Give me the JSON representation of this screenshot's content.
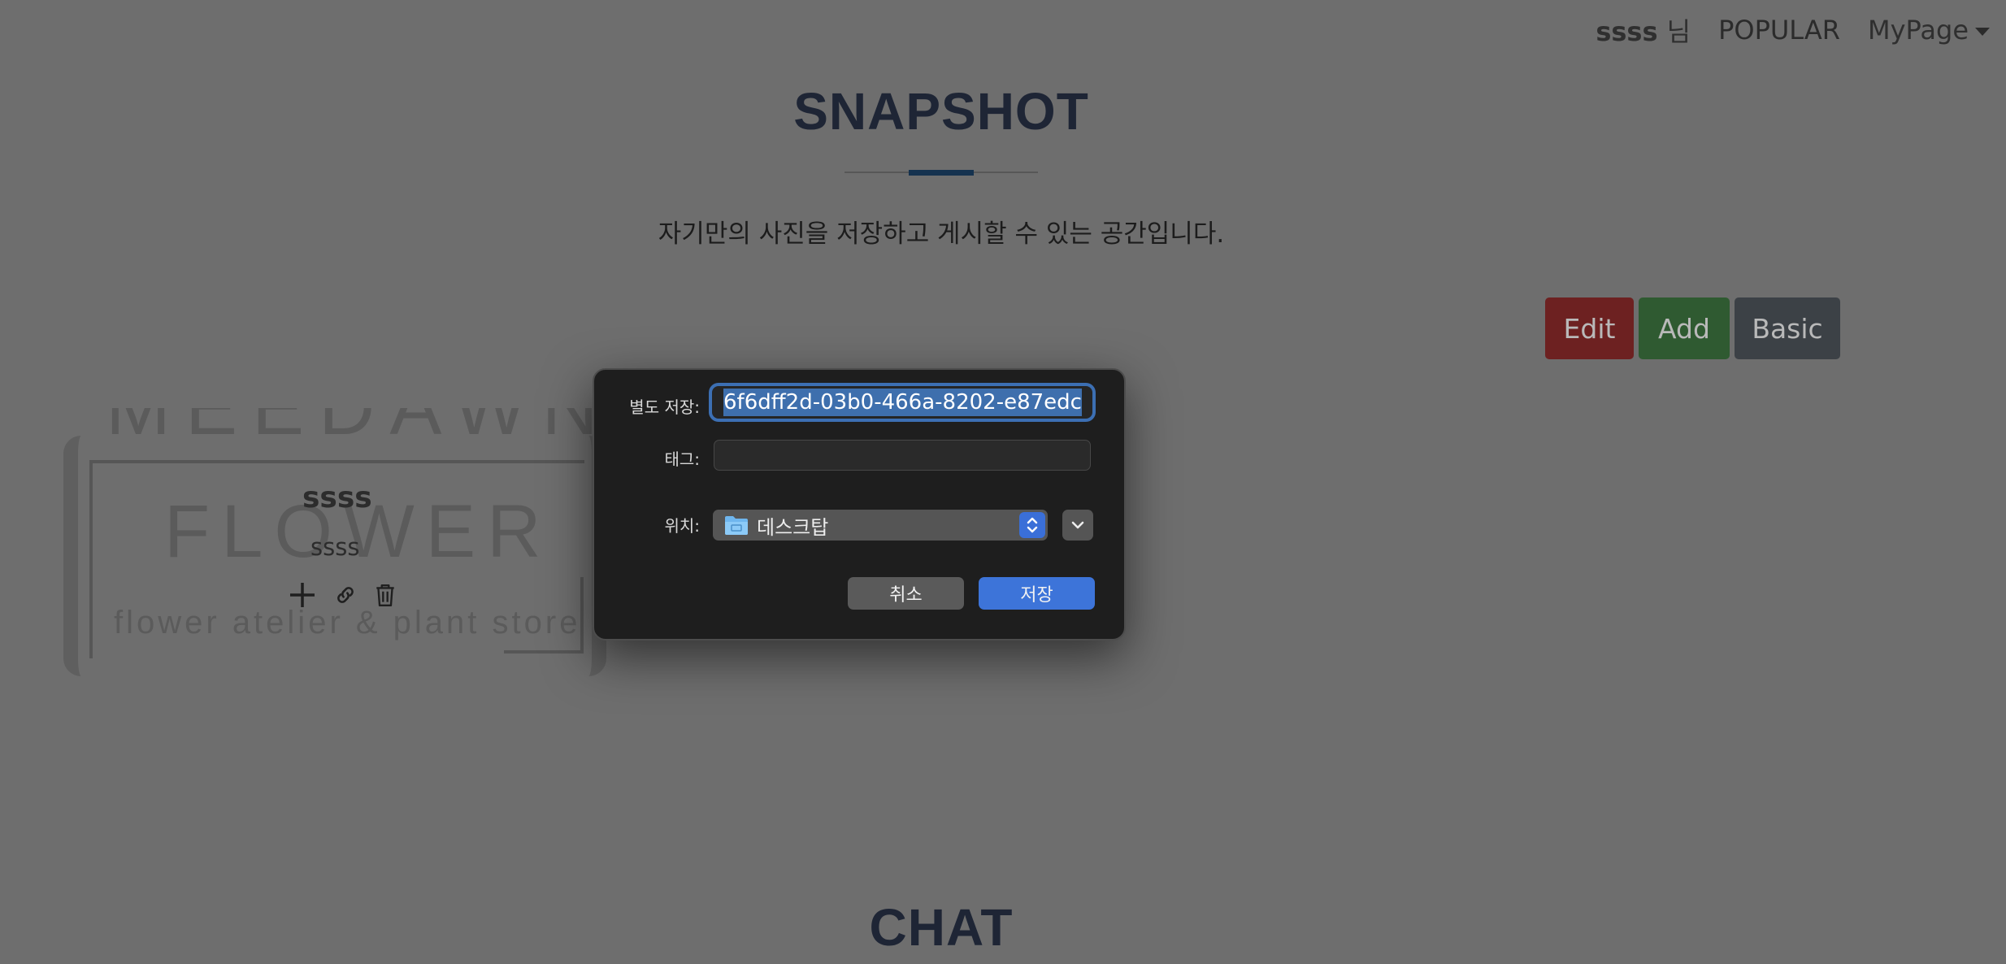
{
  "nav": {
    "user": "ssss",
    "user_suffix": "님",
    "popular": "POPULAR",
    "mypage": "MyPage"
  },
  "snapshot": {
    "title": "SNAPSHOT",
    "subtitle": "자기만의 사진을 저장하고 게시할 수 있는 공간입니다."
  },
  "actions": {
    "edit": "Edit",
    "add": "Add",
    "basic": "Basic"
  },
  "card": {
    "logo_top": "MEEDAWN",
    "logo_main": "FLOWER",
    "logo_tagline": "flower atelier & plant store",
    "name": "ssss",
    "sub": "ssss"
  },
  "dialog": {
    "save_as_label": "별도 저장:",
    "save_as_value": "6f6dff2d-03b0-466a-8202-e87edc",
    "tags_label": "태그:",
    "tags_value": "",
    "where_label": "위치:",
    "where_value": "데스크탑",
    "cancel": "취소",
    "save": "저장"
  },
  "chat": {
    "title": "CHAT"
  },
  "colors": {
    "dialog_bg": "#1e1e1e",
    "accent": "#3d74d9",
    "edit_btn": "#6d2121",
    "add_btn": "#2f5a31",
    "basic_btn": "#3c4146"
  }
}
